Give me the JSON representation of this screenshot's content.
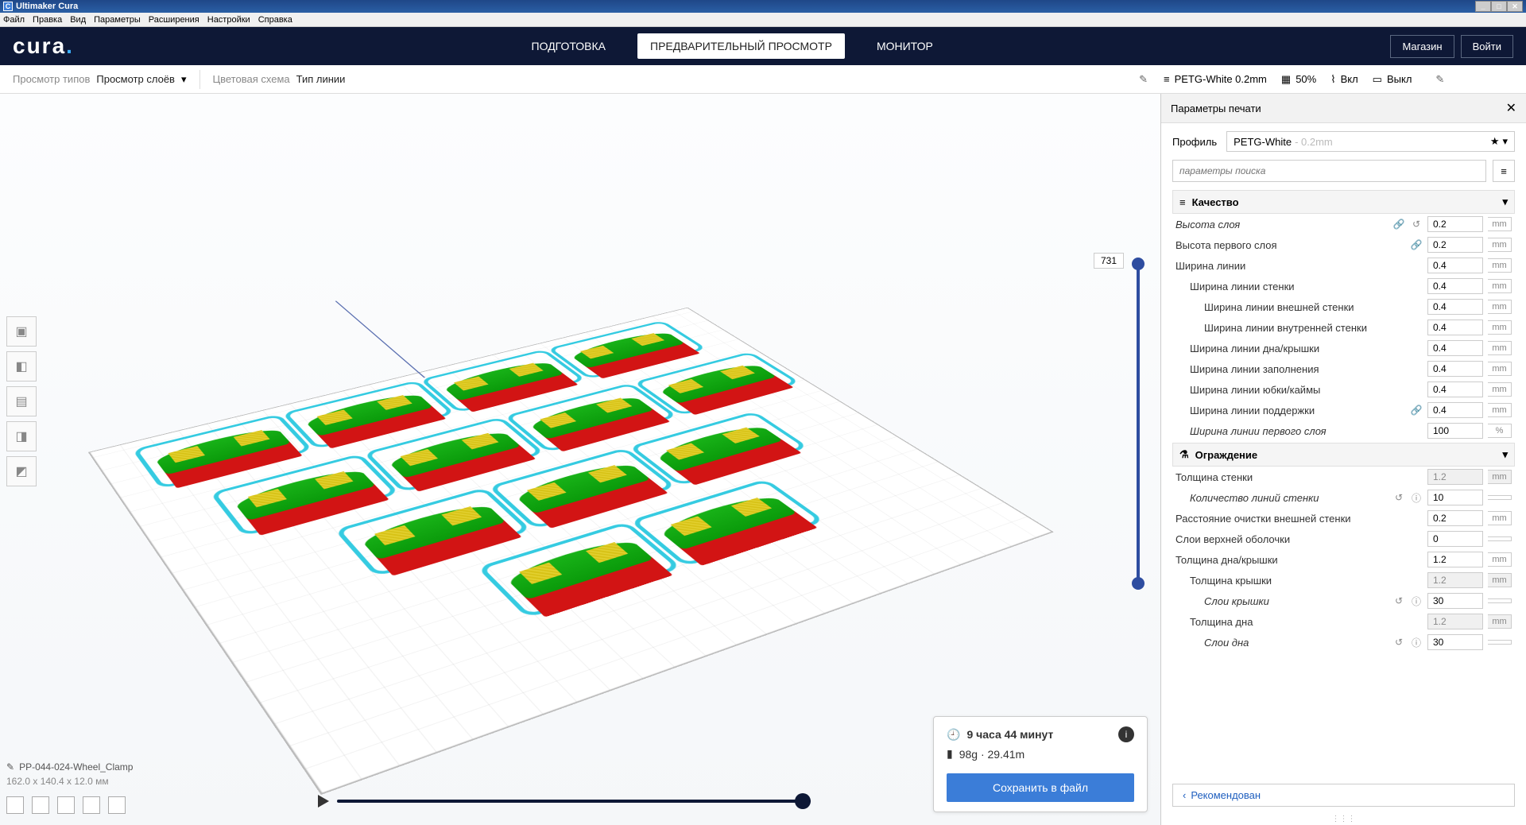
{
  "titlebar": {
    "app": "Ultimaker Cura"
  },
  "menubar": [
    "Файл",
    "Правка",
    "Вид",
    "Параметры",
    "Расширения",
    "Настройки",
    "Справка"
  ],
  "header": {
    "logo": "cura",
    "nav": {
      "prepare": "ПОДГОТОВКА",
      "preview": "ПРЕДВАРИТЕЛЬНЫЙ ПРОСМОТР",
      "monitor": "МОНИТОР"
    },
    "market": "Магазин",
    "login": "Войти"
  },
  "toolbar": {
    "viewTypeLabel": "Просмотр типов",
    "viewTypeValue": "Просмотр слоёв",
    "colorSchemeLabel": "Цветовая схема",
    "colorSchemeValue": "Тип линии",
    "material": "PETG-White 0.2mm",
    "infill": "50%",
    "support": "Вкл",
    "adhesion": "Выкл"
  },
  "panel": {
    "title": "Параметры печати",
    "profileLabel": "Профиль",
    "profileName": "PETG-White",
    "profileDim": "- 0.2mm",
    "searchPlaceholder": "параметры поиска",
    "cat1": "Качество",
    "cat2": "Ограждение",
    "recommend": "Рекомендован",
    "settings": {
      "s1": {
        "label": "Высота слоя",
        "val": "0.2",
        "unit": "mm"
      },
      "s2": {
        "label": "Высота первого слоя",
        "val": "0.2",
        "unit": "mm"
      },
      "s3": {
        "label": "Ширина линии",
        "val": "0.4",
        "unit": "mm"
      },
      "s4": {
        "label": "Ширина линии стенки",
        "val": "0.4",
        "unit": "mm"
      },
      "s5": {
        "label": "Ширина линии внешней стенки",
        "val": "0.4",
        "unit": "mm"
      },
      "s6": {
        "label": "Ширина линии внутренней стенки",
        "val": "0.4",
        "unit": "mm"
      },
      "s7": {
        "label": "Ширина линии дна/крышки",
        "val": "0.4",
        "unit": "mm"
      },
      "s8": {
        "label": "Ширина линии заполнения",
        "val": "0.4",
        "unit": "mm"
      },
      "s9": {
        "label": "Ширина линии юбки/каймы",
        "val": "0.4",
        "unit": "mm"
      },
      "s10": {
        "label": "Ширина линии поддержки",
        "val": "0.4",
        "unit": "mm"
      },
      "s11": {
        "label": "Ширина линии первого слоя",
        "val": "100",
        "unit": "%"
      },
      "w1": {
        "label": "Толщина стенки",
        "val": "1.2",
        "unit": "mm"
      },
      "w2": {
        "label": "Количество линий стенки",
        "val": "10",
        "unit": ""
      },
      "w3": {
        "label": "Расстояние очистки внешней стенки",
        "val": "0.2",
        "unit": "mm"
      },
      "w4": {
        "label": "Слои верхней оболочки",
        "val": "0",
        "unit": ""
      },
      "w5": {
        "label": "Толщина дна/крышки",
        "val": "1.2",
        "unit": "mm"
      },
      "w6": {
        "label": "Толщина крышки",
        "val": "1.2",
        "unit": "mm"
      },
      "w7": {
        "label": "Слои крышки",
        "val": "30",
        "unit": ""
      },
      "w8": {
        "label": "Толщина дна",
        "val": "1.2",
        "unit": "mm"
      },
      "w9": {
        "label": "Слои дна",
        "val": "30",
        "unit": ""
      }
    }
  },
  "estimate": {
    "time": "9 часа 44 минут",
    "material": "98g · 29.41m",
    "save": "Сохранить в файл"
  },
  "model": {
    "name": "PP-044-024-Wheel_Clamp",
    "dims": "162.0 x 140.4 x 12.0 мм"
  },
  "layerSlider": {
    "value": "731"
  }
}
